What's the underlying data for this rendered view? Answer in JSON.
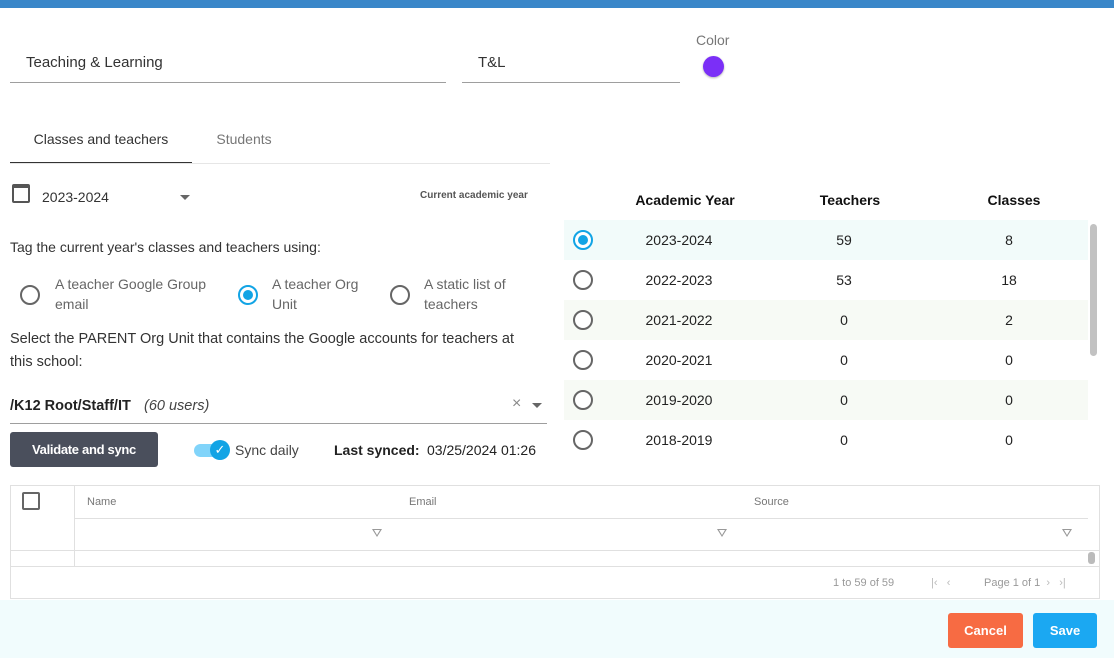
{
  "form": {
    "name_value": "Teaching & Learning",
    "short_name_value": "T&L",
    "color_label": "Color",
    "color_value": "#7b2ff7"
  },
  "tabs": [
    {
      "label": "Classes and teachers",
      "active": true
    },
    {
      "label": "Students",
      "active": false
    }
  ],
  "year_select": {
    "value": "2023-2024",
    "caption": "Current academic year"
  },
  "tag_prompt": "Tag the current year's classes and teachers using:",
  "options": [
    {
      "line1": "A teacher Google Group",
      "line2": "email",
      "selected": false
    },
    {
      "line1": "A teacher Org",
      "line2": "Unit",
      "selected": true
    },
    {
      "line1": "A static list of",
      "line2": "teachers",
      "selected": false
    }
  ],
  "parent_prompt": "Select the PARENT Org Unit that contains the Google accounts for teachers at this school:",
  "org_unit": {
    "path": "/K12 Root/Staff/IT",
    "count": "(60 users)",
    "clear_glyph": "×"
  },
  "actions": {
    "validate_label": "Validate and sync",
    "sync_daily_label": "Sync daily",
    "sync_daily_on": true,
    "last_synced_label": "Last synced:",
    "last_synced_value": "03/25/2024 01:26"
  },
  "years_table": {
    "headers": [
      "Academic Year",
      "Teachers",
      "Classes"
    ],
    "rows": [
      {
        "year": "2023-2024",
        "teachers": "59",
        "classes": "8",
        "selected": true
      },
      {
        "year": "2022-2023",
        "teachers": "53",
        "classes": "18",
        "selected": false
      },
      {
        "year": "2021-2022",
        "teachers": "0",
        "classes": "2",
        "selected": false
      },
      {
        "year": "2020-2021",
        "teachers": "0",
        "classes": "0",
        "selected": false
      },
      {
        "year": "2019-2020",
        "teachers": "0",
        "classes": "0",
        "selected": false
      },
      {
        "year": "2018-2019",
        "teachers": "0",
        "classes": "0",
        "selected": false
      }
    ]
  },
  "grid": {
    "columns": [
      "Name",
      "Email",
      "Source"
    ],
    "pager_range": "1 to 59 of 59",
    "pager_page": "Page 1 of 1"
  },
  "footer": {
    "cancel_label": "Cancel",
    "save_label": "Save"
  },
  "colors": {
    "accent": "#12a4e5",
    "cancel": "#f76b43",
    "save": "#1ba8f2",
    "topbar": "#3a87c9"
  }
}
